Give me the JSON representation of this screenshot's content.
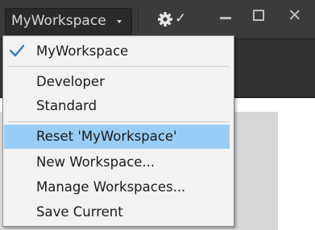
{
  "header": {
    "workspace_selector": "MyWorkspace"
  },
  "menu": {
    "items": [
      {
        "label": "MyWorkspace",
        "checked": true
      },
      {
        "label": "Developer"
      },
      {
        "label": "Standard"
      },
      {
        "label": "Reset 'MyWorkspace'",
        "highlighted": true
      },
      {
        "label": "New Workspace..."
      },
      {
        "label": "Manage Workspaces..."
      },
      {
        "label": "Save Current"
      }
    ]
  },
  "colors": {
    "highlight": "#99cdf5",
    "check": "#3b79c6",
    "menu_bg": "#f2f2f2",
    "topbar_bg": "#3b3b3b"
  }
}
